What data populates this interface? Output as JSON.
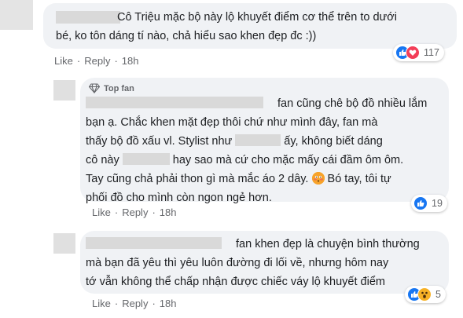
{
  "comment1": {
    "text_lines": [
      "Cô Triệu mặc bộ này lộ khuyết điểm cơ thể trên to dưới",
      "bé, ko tôn dáng tí nào, chả hiểu sao khen đẹp đc :))"
    ],
    "actions": {
      "like": "Like",
      "reply": "Reply",
      "time": "18h"
    },
    "reactions": {
      "count": "117",
      "icons": [
        "like-icon",
        "love-icon"
      ]
    }
  },
  "comment2": {
    "badge": "Top fan",
    "text_lines": [
      [
        "",
        "fan cũng chê bộ đồ nhiều lắm"
      ],
      [
        "bạn ạ. Chắc khen mặt đẹp thôi chứ như mình đây, fan mà",
        ""
      ],
      [
        "thấy bộ đồ xấu vl. Stylist như",
        "ấy, không biết dáng"
      ],
      [
        "cô này",
        "hay sao mà cứ cho mặc mấy cái đầm ôm ôm."
      ],
      [
        "Tay cũng chả phải thon gì mà mắc áo 2 dây.",
        "Bó tay, tôi tự"
      ],
      [
        "phối đồ cho mình còn ngon ngẻ hơn.",
        ""
      ]
    ],
    "actions": {
      "like": "Like",
      "reply": "Reply",
      "time": "18h"
    },
    "reactions": {
      "count": "19",
      "icons": [
        "like-icon"
      ]
    }
  },
  "comment3": {
    "text_lines": [
      "fan khen đẹp là chuyện bình thường",
      "mà bạn đã yêu thì yêu luôn đường đi lối về, nhưng hôm nay",
      "tớ vẫn không thể chấp nhận được chiếc váy lộ khuyết điểm"
    ],
    "actions": {
      "like": "Like",
      "reply": "Reply",
      "time": "18h"
    },
    "reactions": {
      "count": "5",
      "icons": [
        "like-icon",
        "wow-icon"
      ]
    }
  },
  "colors": {
    "bubble": "#f0f2f5",
    "like": "#1877f2",
    "love": "#f33e58",
    "wow": "#f7b125",
    "meta": "#65676b"
  }
}
